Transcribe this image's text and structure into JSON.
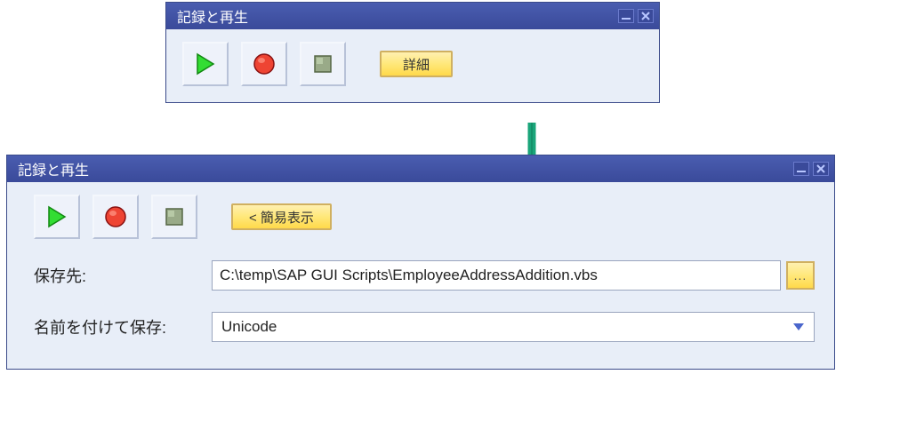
{
  "window1": {
    "title": "記録と再生",
    "buttons": {
      "details": "詳細"
    }
  },
  "window2": {
    "title": "記録と再生",
    "buttons": {
      "simple_view": "< 簡易表示",
      "browse": "..."
    },
    "form": {
      "save_to_label": "保存先:",
      "save_to_value": "C:\\temp\\SAP GUI Scripts\\EmployeeAddressAddition.vbs",
      "save_as_label": "名前を付けて保存:",
      "save_as_value": "Unicode"
    }
  },
  "icons": {
    "play": "play-icon",
    "record": "record-icon",
    "stop": "stop-icon",
    "minimize": "minimize-icon",
    "close": "close-icon"
  }
}
